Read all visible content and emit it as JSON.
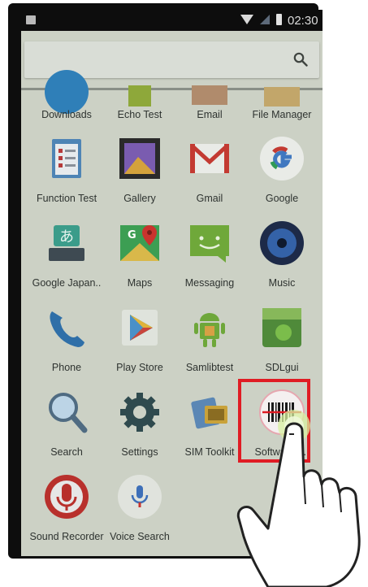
{
  "status_bar": {
    "time": "02:30"
  },
  "search": {
    "placeholder": ""
  },
  "apps": [
    {
      "id": "downloads",
      "label": "Downloads",
      "icon": "downloads-icon"
    },
    {
      "id": "echo-test",
      "label": "Echo Test",
      "icon": "echo-test-icon"
    },
    {
      "id": "email",
      "label": "Email",
      "icon": "email-icon"
    },
    {
      "id": "file-manager",
      "label": "File Manager",
      "icon": "folder-icon"
    },
    {
      "id": "function-test",
      "label": "Function Test",
      "icon": "clipboard-checklist-icon"
    },
    {
      "id": "gallery",
      "label": "Gallery",
      "icon": "gallery-icon"
    },
    {
      "id": "gmail",
      "label": "Gmail",
      "icon": "gmail-icon"
    },
    {
      "id": "google",
      "label": "Google",
      "icon": "google-icon"
    },
    {
      "id": "google-japanese",
      "label": "Google Japan..",
      "icon": "japanese-keyboard-icon"
    },
    {
      "id": "maps",
      "label": "Maps",
      "icon": "maps-icon"
    },
    {
      "id": "messaging",
      "label": "Messaging",
      "icon": "messaging-icon"
    },
    {
      "id": "music",
      "label": "Music",
      "icon": "music-icon"
    },
    {
      "id": "phone",
      "label": "Phone",
      "icon": "phone-icon"
    },
    {
      "id": "play-store",
      "label": "Play Store",
      "icon": "play-store-icon"
    },
    {
      "id": "samlibtest",
      "label": "Samlibtest",
      "icon": "android-icon"
    },
    {
      "id": "sdlgui",
      "label": "SDLgui",
      "icon": "sdlgui-icon"
    },
    {
      "id": "search",
      "label": "Search",
      "icon": "magnifier-icon"
    },
    {
      "id": "settings",
      "label": "Settings",
      "icon": "gear-icon"
    },
    {
      "id": "sim-toolkit",
      "label": "SIM Toolkit",
      "icon": "sim-card-icon"
    },
    {
      "id": "software-trigger",
      "label": "SoftwareTr..",
      "icon": "barcode-scanner-icon"
    },
    {
      "id": "sound-recorder",
      "label": "Sound Recorder",
      "icon": "microphone-icon"
    },
    {
      "id": "voice-search",
      "label": "Voice Search",
      "icon": "voice-search-icon"
    }
  ],
  "colors": {
    "screen_overlay": "#ccd1c5",
    "highlight": "#e01c24",
    "status_bar": "#0d0d0d"
  }
}
